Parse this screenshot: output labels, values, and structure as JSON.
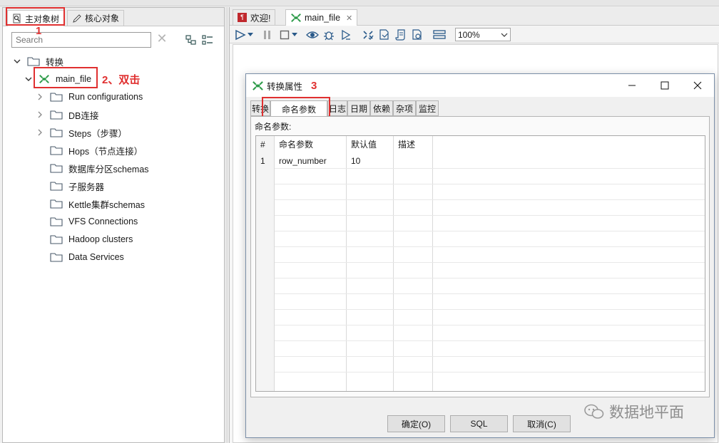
{
  "left": {
    "tabs": [
      {
        "label": "主对象树",
        "icon": "object-tree-icon"
      },
      {
        "label": "核心对象",
        "icon": "pencil-icon"
      }
    ],
    "search_placeholder": "Search",
    "tree": {
      "root": "转换",
      "file": "main_file",
      "children": [
        "Run configurations",
        "DB连接",
        "Steps（步骤）",
        "Hops（节点连接）",
        "数据库分区schemas",
        "子服务器",
        "Kettle集群schemas",
        "VFS Connections",
        "Hadoop clusters",
        "Data Services"
      ]
    },
    "annotations": {
      "step1": "1",
      "step2": "2、双击"
    }
  },
  "right": {
    "tabs": [
      {
        "label": "欢迎!",
        "icon": "welcome-icon"
      },
      {
        "label": "main_file",
        "icon": "transformation-icon",
        "closable": true
      }
    ],
    "zoom": "100%"
  },
  "dialog": {
    "title": "转换属性",
    "annotation": "3",
    "tabs": [
      "转换",
      "命名参数",
      "日志",
      "日期",
      "依赖",
      "杂项",
      "监控"
    ],
    "active_tab": "命名参数",
    "section_label": "命名参数:",
    "table": {
      "columns": [
        "#",
        "命名参数",
        "默认值",
        "描述"
      ],
      "rows": [
        {
          "num": "1",
          "name": "row_number",
          "default": "10",
          "desc": ""
        }
      ]
    },
    "buttons": [
      "确定(O)",
      "SQL",
      "取消(C)"
    ]
  },
  "watermark": "数据地平面",
  "colors": {
    "annotation_red": "#e03030",
    "transformation_green": "#2e9b4a"
  }
}
